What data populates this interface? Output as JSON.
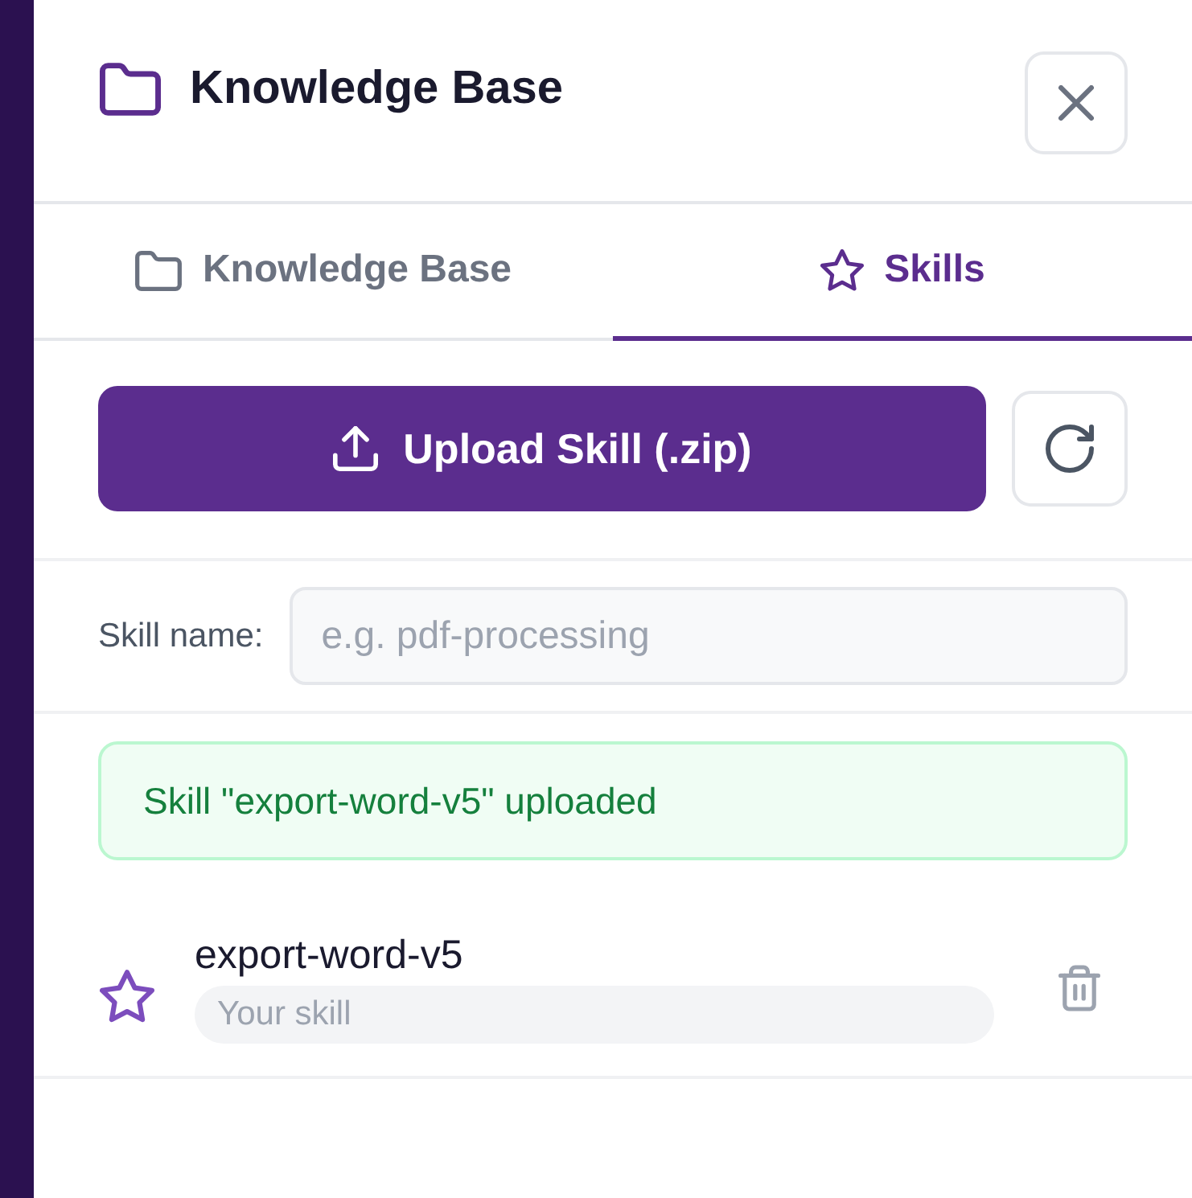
{
  "panel": {
    "title": "Knowledge Base"
  },
  "tabs": [
    {
      "label": "Knowledge Base",
      "kind": "knowledge",
      "selected": false
    },
    {
      "label": "Skills",
      "kind": "skills",
      "selected": true
    }
  ],
  "upload_button": {
    "label": "Upload Skill (.zip)"
  },
  "skill_name": {
    "label": "Skill name:",
    "placeholder": "e.g. pdf-processing"
  },
  "notice": {
    "kind": "success",
    "text": "Skill \"export-word-v5\" uploaded"
  },
  "skills": [
    {
      "name": "export-word-v5",
      "description": {
        "placeholder": "Your skill"
      }
    }
  ]
}
